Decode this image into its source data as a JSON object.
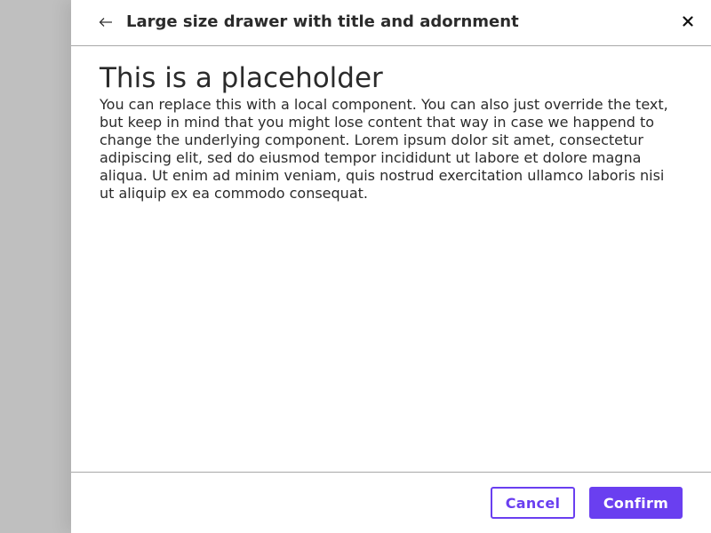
{
  "drawer": {
    "title": "Large size drawer with title and adornment",
    "back_icon": "arrow-left-icon",
    "close_icon": "close-icon"
  },
  "content": {
    "heading": "This is a placeholder",
    "body": "You can replace this with a local component. You can also just override the text, but keep in mind that you might lose content that way in case we happend to change the underlying component. Lorem ipsum dolor sit amet, consectetur adipiscing elit, sed do eiusmod tempor incididunt ut labore et dolore magna aliqua. Ut enim ad minim veniam, quis nostrud exercitation ullamco laboris nisi ut aliquip ex ea commodo consequat."
  },
  "footer": {
    "cancel_label": "Cancel",
    "confirm_label": "Confirm"
  },
  "colors": {
    "overlay": "#bfbfbf",
    "accent": "#6a3ff0",
    "text": "#2b2b2b",
    "divider": "#a8a8a8"
  }
}
